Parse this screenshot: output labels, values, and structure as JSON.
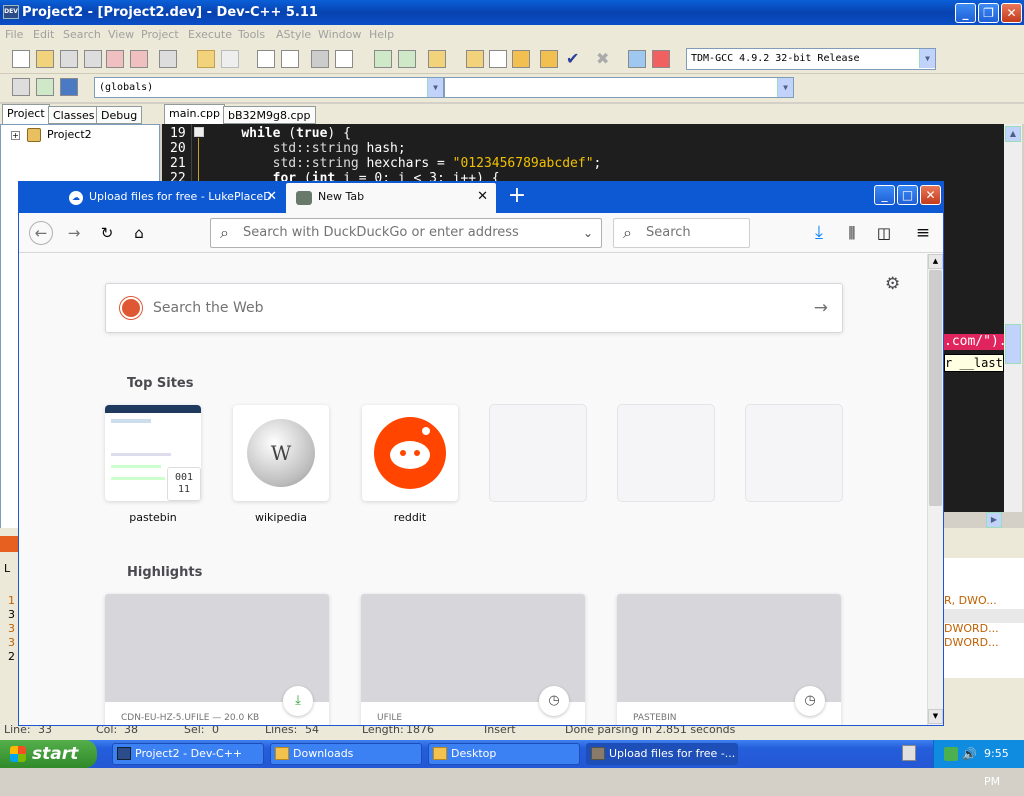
{
  "devcpp": {
    "title": "Project2 - [Project2.dev] - Dev-C++ 5.11",
    "menu": [
      "File",
      "Edit",
      "Search",
      "View",
      "Project",
      "Execute",
      "Tools",
      "AStyle",
      "Window",
      "Help"
    ],
    "compiler": "TDM-GCC 4.9.2 32-bit Release",
    "globals": "(globals)",
    "left_tabs": [
      "Project",
      "Classes",
      "Debug"
    ],
    "tree_root": "Project2",
    "editor_tabs": [
      "main.cpp",
      "bB32M9g8.cpp"
    ],
    "code": [
      {
        "ln": "19",
        "text": "    while (true) {"
      },
      {
        "ln": "20",
        "text": "        std::string hash;"
      },
      {
        "ln": "21",
        "text": "        std::string hexchars = \"0123456789abcdef\";"
      },
      {
        "ln": "22",
        "text": "        for (int i = 0; i < 3; i++) {"
      }
    ],
    "right_peek": [
      ".com/\").",
      "r __last)"
    ],
    "bottom_right_peek": [
      "R, DWO...",
      "DWORD...",
      "DWORD..."
    ],
    "bottom_left_peek": [
      "L",
      "1",
      "3",
      "3",
      "3",
      "2"
    ],
    "status": {
      "line": "Line:",
      "line_val": "33",
      "col": "Col:",
      "col_val": "38",
      "sel": "Sel:",
      "sel_val": "0",
      "lines": "Lines:",
      "lines_val": "54",
      "length": "Length:",
      "length_val": "1876",
      "mode": "Insert",
      "parse": "Done parsing in 2.851 seconds"
    }
  },
  "firefox": {
    "tabs": [
      {
        "label": "Upload files for free - LukePlaceD"
      },
      {
        "label": "New Tab"
      }
    ],
    "url_placeholder": "Search with DuckDuckGo or enter address",
    "search_placeholder": "Search",
    "web_search_placeholder": "Search the Web",
    "top_sites_title": "Top Sites",
    "top_sites": [
      {
        "label": "pastebin"
      },
      {
        "label": "wikipedia"
      },
      {
        "label": "reddit"
      },
      {
        "label": ""
      },
      {
        "label": ""
      },
      {
        "label": ""
      }
    ],
    "highlights_title": "Highlights",
    "highlights": [
      {
        "meta": "CDN-EU-HZ-5.UFILE — 20.0 KB",
        "icon": "download-icon"
      },
      {
        "meta": "UFILE",
        "icon": "clock-icon"
      },
      {
        "meta": "PASTEBIN",
        "icon": "clock-icon"
      }
    ]
  },
  "taskbar": {
    "start": "start",
    "tasks": [
      "Project2 - Dev-C++",
      "Downloads",
      "Desktop",
      "Upload files for free -..."
    ],
    "clock": "9:55 PM"
  },
  "colors": {
    "xp_blue": "#0c59d3",
    "editor_bg": "#1e1e1e",
    "string_yellow": "#f0c000",
    "reddit": "#ff4500",
    "accent": "#0a84ff"
  }
}
